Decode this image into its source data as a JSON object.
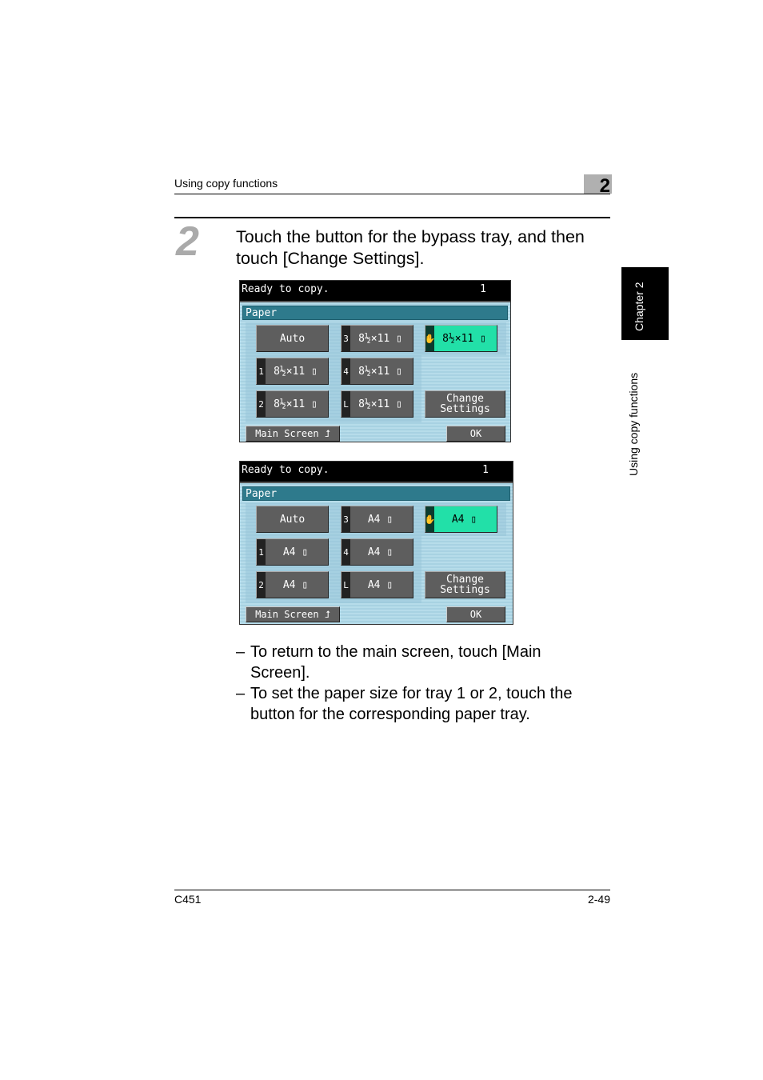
{
  "header": {
    "section": "Using copy functions",
    "chapter_num": "2"
  },
  "side": {
    "chapter_tab": "Chapter 2",
    "section": "Using copy functions"
  },
  "step": {
    "number": "2",
    "text": "Touch the button for the bypass tray, and then touch [Change Settings]."
  },
  "screens": [
    {
      "status": "Ready to copy.",
      "count": "1",
      "section": "Paper",
      "buttons": {
        "auto": "Auto",
        "tray3": "8½×11 ▯",
        "bypass": "8½×11 ▯",
        "tray1": "8½×11 ▯",
        "tray4": "8½×11 ▯",
        "tray2": "8½×11 ▯",
        "trayL": "8½×11 ▯",
        "change1": "Change",
        "change2": "Settings"
      },
      "tabs": {
        "t1": "1",
        "t2": "2",
        "t3": "3",
        "t4": "4",
        "tL": "L",
        "bypass": "✋"
      },
      "main_screen": "Main Screen ⮥",
      "ok": "OK"
    },
    {
      "status": "Ready to copy.",
      "count": "1",
      "section": "Paper",
      "buttons": {
        "auto": "Auto",
        "tray3": "A4 ▯",
        "bypass": "A4 ▯",
        "tray1": "A4 ▯",
        "tray4": "A4 ▯",
        "tray2": "A4 ▯",
        "trayL": "A4 ▯",
        "change1": "Change",
        "change2": "Settings"
      },
      "tabs": {
        "t1": "1",
        "t2": "2",
        "t3": "3",
        "t4": "4",
        "tL": "L",
        "bypass": "✋"
      },
      "main_screen": "Main Screen ⮥",
      "ok": "OK"
    }
  ],
  "bullets": [
    {
      "dash": "–",
      "text": "To return to the main screen, touch [Main Screen]."
    },
    {
      "dash": "–",
      "text": "To set the paper size for tray 1 or 2, touch the button for the corresponding paper tray."
    }
  ],
  "footer": {
    "model": "C451",
    "page": "2-49"
  },
  "colors": {
    "selected": "#22e0a8",
    "paper_bar": "#2e7a8c",
    "button": "#5e5e5e"
  }
}
